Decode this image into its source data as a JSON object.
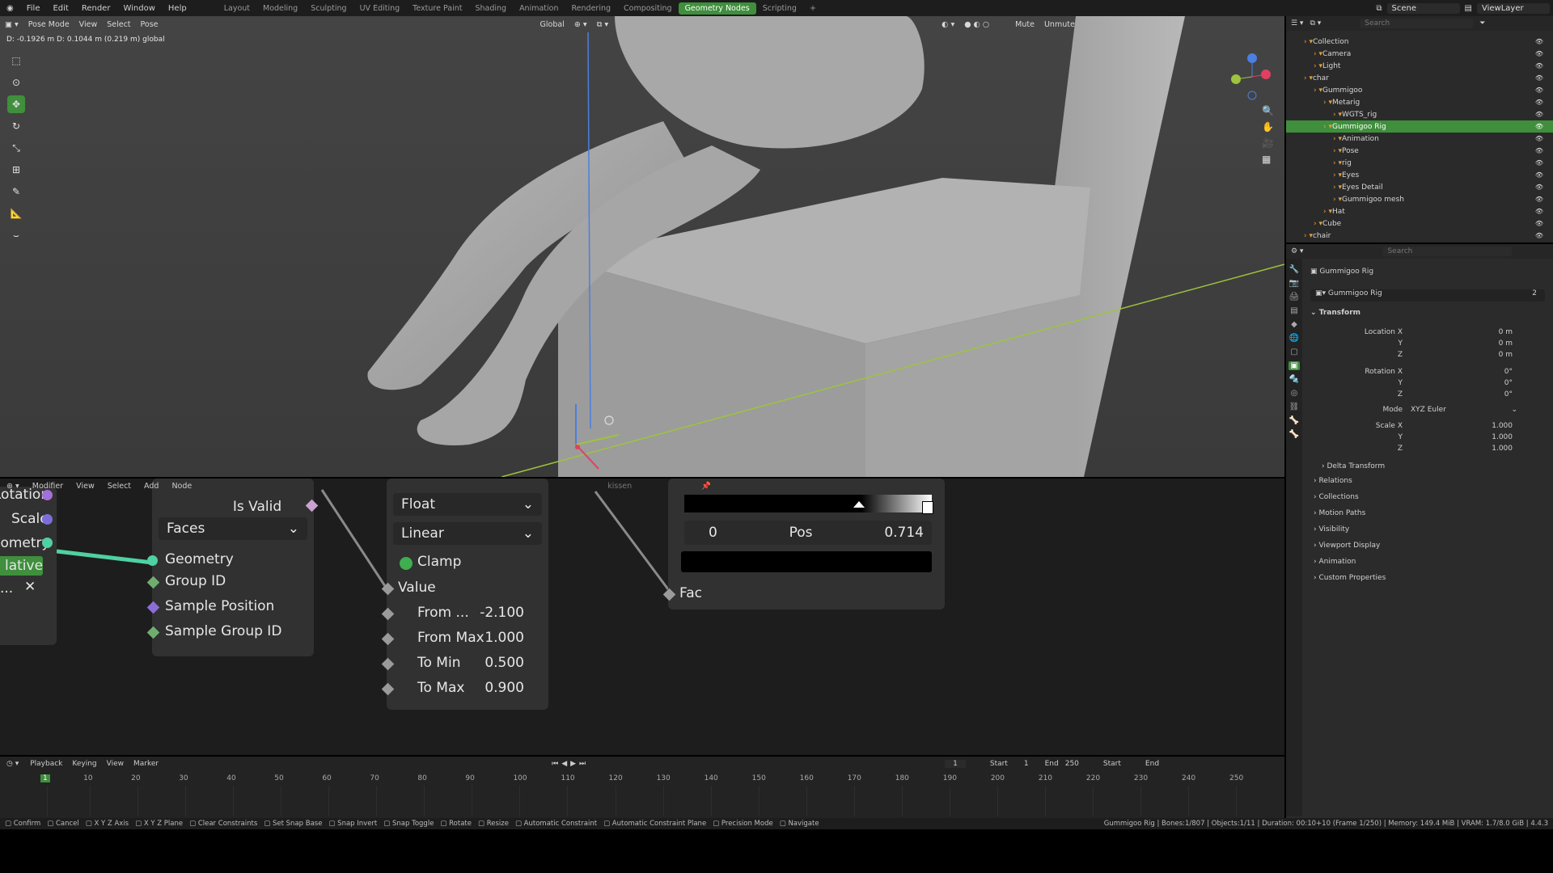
{
  "topbar": {
    "menus": [
      "File",
      "Edit",
      "Render",
      "Window",
      "Help"
    ],
    "workspaces": [
      "Layout",
      "Modeling",
      "Sculpting",
      "UV Editing",
      "Texture Paint",
      "Shading",
      "Animation",
      "Rendering",
      "Compositing",
      "Geometry Nodes",
      "Scripting"
    ],
    "active_workspace": "Geometry Nodes",
    "scene": "Scene",
    "view_layer": "ViewLayer"
  },
  "viewport": {
    "mode": "Pose Mode",
    "menus": [
      "View",
      "Select",
      "Pose"
    ],
    "orientation": "Global",
    "mute": "Mute",
    "unmute": "Unmute",
    "info": "D: -0.1926 m  D: 0.1044 m (0.219 m) global"
  },
  "outliner": {
    "search_placeholder": "Search",
    "items": [
      {
        "label": "Collection",
        "depth": 1
      },
      {
        "label": "Camera",
        "depth": 2
      },
      {
        "label": "Light",
        "depth": 2
      },
      {
        "label": "char",
        "depth": 1
      },
      {
        "label": "Gummigoo",
        "depth": 2
      },
      {
        "label": "Metarig",
        "depth": 3
      },
      {
        "label": "WGTS_rig",
        "depth": 4
      },
      {
        "label": "Gummigoo Rig",
        "depth": 3,
        "selected": true
      },
      {
        "label": "Animation",
        "depth": 4
      },
      {
        "label": "Pose",
        "depth": 4
      },
      {
        "label": "rig",
        "depth": 4
      },
      {
        "label": "Eyes",
        "depth": 4
      },
      {
        "label": "Eyes Detail",
        "depth": 4
      },
      {
        "label": "Gummigoo mesh",
        "depth": 4
      },
      {
        "label": "Hat",
        "depth": 3
      },
      {
        "label": "Cube",
        "depth": 2
      },
      {
        "label": "chair",
        "depth": 1
      }
    ]
  },
  "properties": {
    "search_placeholder": "Search",
    "header_object": "Gummigoo Rig",
    "data_name": "Gummigoo Rig",
    "users": "2",
    "transform_label": "Transform",
    "location_label": "Location X",
    "location": [
      "0 m",
      "0 m",
      "0 m"
    ],
    "rotation_label": "Rotation X",
    "rotation": [
      "0°",
      "0°",
      "0°"
    ],
    "mode_label": "Mode",
    "mode_value": "XYZ Euler",
    "scale_label": "Scale X",
    "scale": [
      "1.000",
      "1.000",
      "1.000"
    ],
    "axis_y": "Y",
    "axis_z": "Z",
    "delta": "Delta Transform",
    "panels": [
      "Relations",
      "Collections",
      "Motion Paths",
      "Visibility",
      "Viewport Display",
      "Animation",
      "Custom Properties"
    ]
  },
  "node_editor": {
    "header_menus": [
      "Modifier",
      "View",
      "Select",
      "Add",
      "Node"
    ],
    "modifier_name": "kissen",
    "left_node": {
      "rotation": "Rotation",
      "scale": "Scale",
      "geometry": "eometry",
      "relative": "lative",
      "dots": "..."
    },
    "sample_node": {
      "is_valid": "Is Valid",
      "domain": "Faces",
      "inputs": [
        "Geometry",
        "Group ID",
        "Sample Position",
        "Sample Group ID"
      ]
    },
    "map_range": {
      "data_type": "Float",
      "interp": "Linear",
      "clamp": "Clamp",
      "value": "Value",
      "rows": [
        {
          "label": "From ...",
          "value": "-2.100"
        },
        {
          "label": "From Max",
          "value": "1.000"
        },
        {
          "label": "To Min",
          "value": "0.500"
        },
        {
          "label": "To Max",
          "value": "0.900"
        }
      ]
    },
    "color_ramp": {
      "index": "0",
      "pos_label": "Pos",
      "pos_value": "0.714",
      "fac": "Fac",
      "stop_positions": [
        0.714,
        1.0
      ]
    }
  },
  "timeline": {
    "menus": [
      "Playback",
      "Keying",
      "View",
      "Marker"
    ],
    "current_frame": "1",
    "start_label": "Start",
    "start": "1",
    "end_label": "End",
    "end": "250",
    "start2": "Start",
    "end2": "End",
    "ticks": [
      "1",
      "10",
      "20",
      "30",
      "40",
      "50",
      "60",
      "70",
      "80",
      "90",
      "100",
      "110",
      "120",
      "130",
      "140",
      "150",
      "160",
      "170",
      "180",
      "190",
      "200",
      "210",
      "220",
      "230",
      "240",
      "250"
    ]
  },
  "statusbar": {
    "items": [
      "Confirm",
      "Cancel",
      "X Y Z Axis",
      "X Y Z Plane",
      "Clear Constraints",
      "Set Snap Base",
      "Snap Invert",
      "Snap Toggle",
      "Rotate",
      "Resize",
      "Automatic Constraint",
      "Automatic Constraint Plane",
      "Precision Mode",
      "Navigate"
    ],
    "info": "Gummigoo Rig | Bones:1/807 | Objects:1/11 | Duration: 00:10+10 (Frame 1/250) | Memory: 149.4 MiB | VRAM: 1.7/8.0 GiB | 4.4.3"
  }
}
